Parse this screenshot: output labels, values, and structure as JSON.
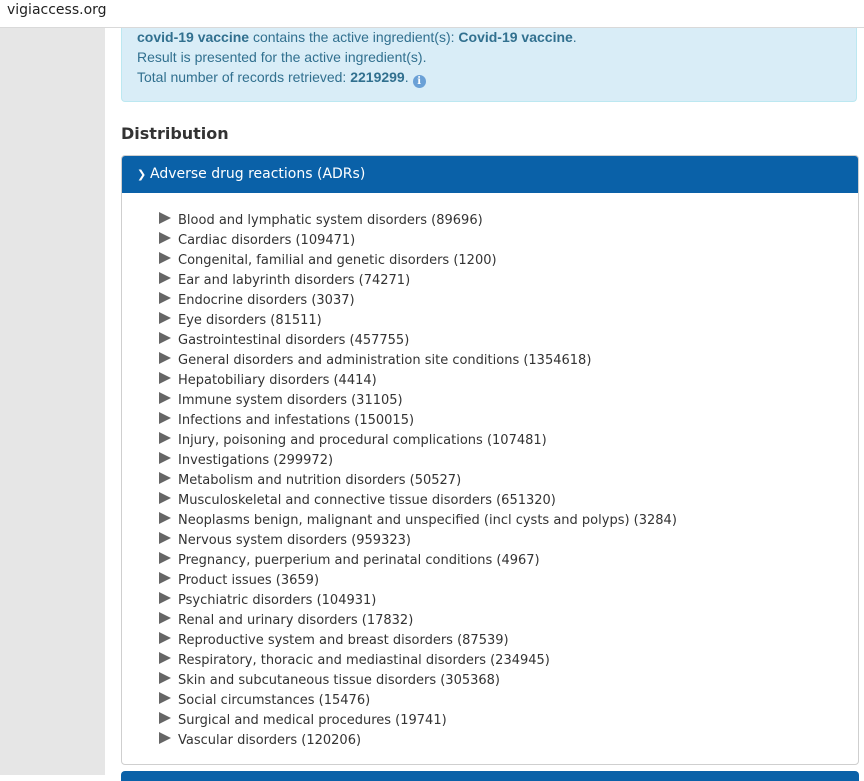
{
  "browser": {
    "url": "vigiaccess.org"
  },
  "info": {
    "drug_name": "covid-19 vaccine",
    "contains_text": " contains the active ingredient(s): ",
    "ingredient": "Covid-19 vaccine",
    "period": ".",
    "line2": "Result is presented for the active ingredient(s).",
    "records_label": "Total number of records retrieved: ",
    "records_count": "2219299",
    "records_period": ".",
    "info_icon_glyph": "i"
  },
  "distribution": {
    "title": "Distribution",
    "panel_title": "Adverse drug reactions (ADRs)",
    "items": [
      "Blood and lymphatic system disorders (89696)",
      "Cardiac disorders (109471)",
      "Congenital, familial and genetic disorders (1200)",
      "Ear and labyrinth disorders (74271)",
      "Endocrine disorders (3037)",
      "Eye disorders (81511)",
      "Gastrointestinal disorders (457755)",
      "General disorders and administration site conditions (1354618)",
      "Hepatobiliary disorders (4414)",
      "Immune system disorders (31105)",
      "Infections and infestations (150015)",
      "Injury, poisoning and procedural complications (107481)",
      "Investigations (299972)",
      "Metabolism and nutrition disorders (50527)",
      "Musculoskeletal and connective tissue disorders (651320)",
      "Neoplasms benign, malignant and unspecified (incl cysts and polyps) (3284)",
      "Nervous system disorders (959323)",
      "Pregnancy, puerperium and perinatal conditions (4967)",
      "Product issues (3659)",
      "Psychiatric disorders (104931)",
      "Renal and urinary disorders (17832)",
      "Reproductive system and breast disorders (87539)",
      "Respiratory, thoracic and mediastinal disorders (234945)",
      "Skin and subcutaneous tissue disorders (305368)",
      "Social circumstances (15476)",
      "Surgical and medical procedures (19741)",
      "Vascular disorders (120206)"
    ]
  },
  "colors": {
    "panel_header": "#0a61a8",
    "info_bg": "#d9edf7",
    "info_text": "#31708f"
  },
  "icons": {
    "collapse": "chevron-down-icon",
    "expand": "triangle-right-icon",
    "info": "info-icon"
  }
}
